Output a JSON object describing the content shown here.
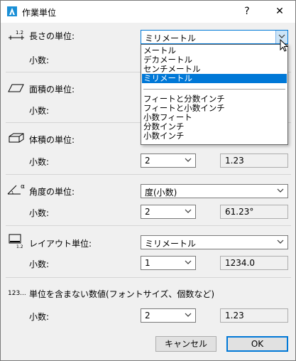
{
  "window": {
    "title": "作業単位",
    "help_label": "?",
    "close_label": "✕"
  },
  "length": {
    "label": "長さの単位:",
    "icon_text": "1.2",
    "unit_value": "ミリメートル",
    "decimals_label": "小数:"
  },
  "dropdown": {
    "items": [
      "メートル",
      "デカメートル",
      "センチメートル",
      "ミリメートル"
    ],
    "items2": [
      "フィートと分数インチ",
      "フィートと小数インチ",
      "小数フィート",
      "分数インチ",
      "小数インチ"
    ],
    "selected": "ミリメートル"
  },
  "area": {
    "label": "面積の単位:",
    "decimals_label": "小数:"
  },
  "volume": {
    "label": "体積の単位:",
    "decimals_label": "小数:",
    "decimals_value": "2",
    "sample": "1.23"
  },
  "angle": {
    "label": "角度の単位:",
    "icon_text": "α",
    "unit_value": "度(小数)",
    "decimals_label": "小数:",
    "decimals_value": "2",
    "sample": "61.23°"
  },
  "layout": {
    "label": "レイアウト単位:",
    "icon_text": "1.2",
    "unit_value": "ミリメートル",
    "decimals_label": "小数:",
    "decimals_value": "1",
    "sample": "1234.0"
  },
  "unitless": {
    "icon_text": "123...",
    "label": "単位を含まない数値(フォントサイズ、個数など)",
    "decimals_label": "小数:",
    "decimals_value": "2",
    "sample": "1.23"
  },
  "buttons": {
    "cancel": "キャンセル",
    "ok": "OK"
  }
}
